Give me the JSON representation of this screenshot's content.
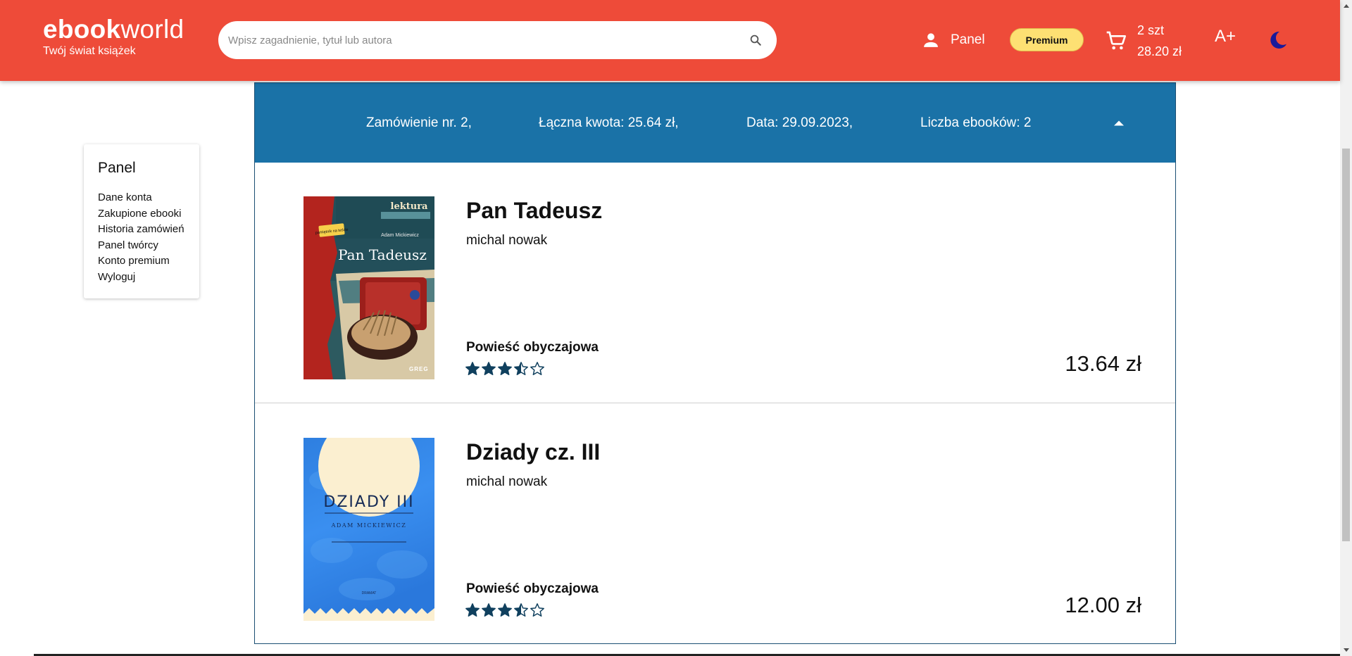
{
  "header": {
    "logo_bold": "ebook",
    "logo_light": "world",
    "tagline": "Twój świat książek",
    "search_placeholder": "Wpisz zagadnienie, tytuł lub autora",
    "search_icon": "search-icon",
    "panel_label": "Panel",
    "premium_label": "Premium",
    "cart_count": "2 szt",
    "cart_total": "28.20 zł",
    "font_size_label": "A+",
    "theme_icon": "moon-icon",
    "colors": {
      "header_bg": "#ee4b39",
      "premium_bg": "#fde073",
      "moon": "#1a1a9a"
    }
  },
  "sidebar": {
    "title": "Panel",
    "items": [
      {
        "label": "Dane konta"
      },
      {
        "label": "Zakupione ebooki"
      },
      {
        "label": "Historia zamówień"
      },
      {
        "label": "Panel twórcy"
      },
      {
        "label": "Konto premium"
      },
      {
        "label": "Wyloguj"
      }
    ]
  },
  "order": {
    "number": "Zamówienie nr. 2,",
    "total": "Łączna kwota: 25.64 zł,",
    "date": "Data: 29.09.2023,",
    "count": "Liczba ebooków: 2",
    "toggle_icon": "chevron-up-icon",
    "colors": {
      "header_bg": "#1a72a7",
      "border": "#1b4e73",
      "star": "#10405e"
    },
    "items": [
      {
        "title": "Pan Tadeusz",
        "author": "michal nowak",
        "genre": "Powieść obyczajowa",
        "price": "13.64 zł",
        "rating": 3.5,
        "rating_max": 5,
        "cover": {
          "badge": "lektura",
          "cover_author": "Adam Mickiewicz",
          "cover_title": "Pan Tadeusz",
          "publisher": "GREG",
          "sticker": "pamiętnik na teście"
        }
      },
      {
        "title": "Dziady cz. III",
        "author": "michal nowak",
        "genre": "Powieść obyczajowa",
        "price": "12.00 zł",
        "rating": 3.5,
        "rating_max": 5,
        "cover": {
          "cover_title": "DZIADY III",
          "cover_author": "ADAM MICKIEWICZ",
          "cover_genre": "DRAMAT"
        }
      }
    ]
  }
}
